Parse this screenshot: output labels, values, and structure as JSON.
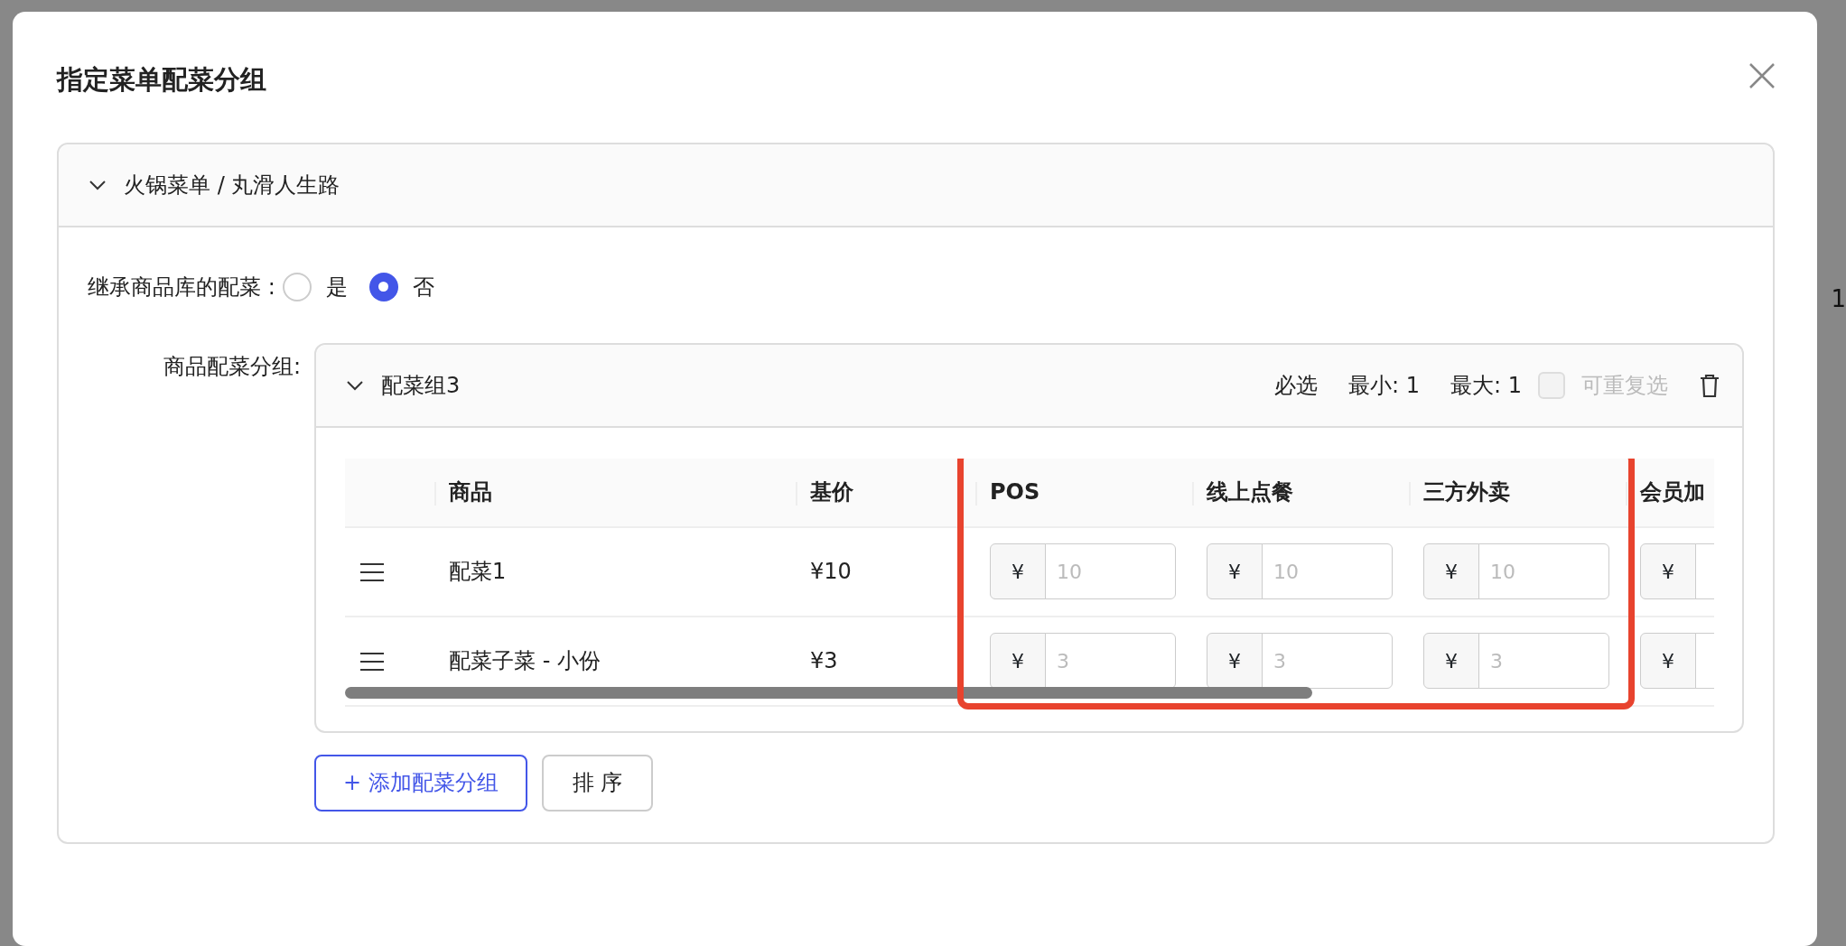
{
  "backdrop": {
    "fragment": "1"
  },
  "dialog": {
    "title": "指定菜单配菜分组"
  },
  "menu_panel": {
    "title": "火锅菜单 / 丸滑人生路",
    "expanded": true,
    "inherit": {
      "label": "继承商品库的配菜 :",
      "options": [
        {
          "label": "是",
          "selected": false
        },
        {
          "label": "否",
          "selected": true
        }
      ]
    },
    "groups_label": "商品配菜分组:",
    "group": {
      "title": "配菜组3",
      "expanded": true,
      "required": "必选",
      "min": "最小: 1",
      "max": "最大: 1",
      "repeatable": {
        "label": "可重复选",
        "checked": false,
        "disabled": true
      },
      "table": {
        "columns": [
          {
            "label": "商品",
            "kind": "text",
            "highlighted": false
          },
          {
            "label": "基价",
            "kind": "text",
            "highlighted": false
          },
          {
            "label": "POS",
            "kind": "price",
            "highlighted": true
          },
          {
            "label": "线上点餐",
            "kind": "price",
            "highlighted": true
          },
          {
            "label": "三方外卖",
            "kind": "price",
            "highlighted": true
          },
          {
            "label": "会员加",
            "kind": "price",
            "highlighted": false
          }
        ],
        "rows": [
          {
            "cells": [
              {
                "text": "配菜1"
              },
              {
                "text": "¥10"
              },
              {
                "prefix": "¥",
                "placeholder": "10"
              },
              {
                "prefix": "¥",
                "placeholder": "10"
              },
              {
                "prefix": "¥",
                "placeholder": "10"
              },
              {
                "prefix": "¥"
              }
            ]
          },
          {
            "cells": [
              {
                "text": "配菜子菜 - 小份"
              },
              {
                "text": "¥3"
              },
              {
                "prefix": "¥",
                "placeholder": "3"
              },
              {
                "prefix": "¥",
                "placeholder": "3"
              },
              {
                "prefix": "¥",
                "placeholder": "3"
              },
              {
                "prefix": "¥"
              }
            ]
          }
        ]
      }
    },
    "buttons": [
      {
        "label": "+ 添加配菜分组",
        "kind": "primary"
      },
      {
        "label": "排 序",
        "kind": "default"
      }
    ]
  }
}
